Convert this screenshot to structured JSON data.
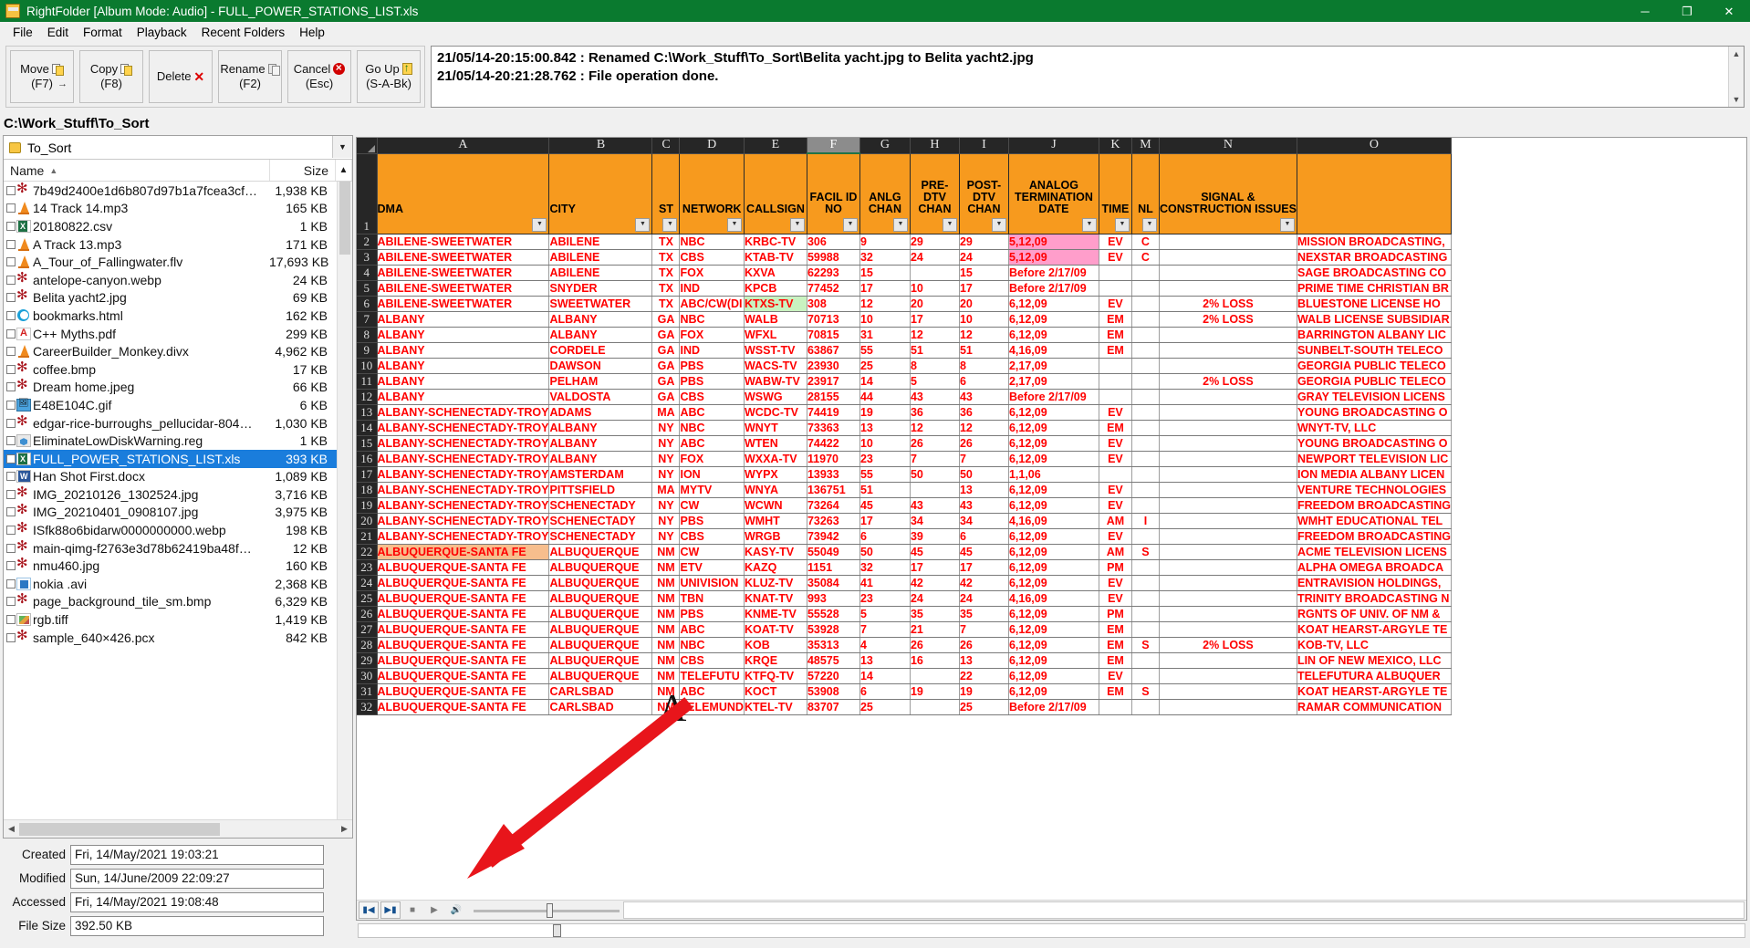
{
  "window": {
    "title": "RightFolder [Album Mode: Audio] - FULL_POWER_STATIONS_LIST.xls",
    "minimize": "─",
    "maximize": "❐",
    "close": "✕"
  },
  "menu": [
    "File",
    "Edit",
    "Format",
    "Playback",
    "Recent Folders",
    "Help"
  ],
  "toolbar": {
    "buttons": [
      {
        "l1": "Move",
        "l2": "(F7)",
        "icon": "move-pages-icon"
      },
      {
        "l1": "Copy",
        "l2": "(F8)",
        "icon": "copy-pages-icon"
      },
      {
        "l1": "Delete",
        "l2": "",
        "icon": "red-x-icon"
      },
      {
        "l1": "Rename",
        "l2": "(F2)",
        "icon": "rename-pages-icon"
      },
      {
        "l1": "Cancel",
        "l2": "(Esc)",
        "icon": "red-circle-x-icon"
      },
      {
        "l1": "Go Up",
        "l2": "(S-A-Bk)",
        "icon": "up-arrow-folder-icon"
      }
    ]
  },
  "log": {
    "lines": [
      "21/05/14-20:15:00.842 : Renamed C:\\Work_Stuff\\To_Sort\\Belita yacht.jpg to Belita yacht2.jpg",
      "21/05/14-20:21:28.762 : File operation done."
    ]
  },
  "path": "C:\\Work_Stuff\\To_Sort",
  "folder_combo": {
    "value": "To_Sort"
  },
  "file_list": {
    "columns": [
      "Name",
      "Size"
    ],
    "sort_indicator": "▲",
    "rows": [
      {
        "name": "7b49d2400e1d6b807d97b1a7fcea3cf…",
        "size": "1,938 KB",
        "icon": "i-img"
      },
      {
        "name": "14 Track 14.mp3",
        "size": "165 KB",
        "icon": "i-vlc"
      },
      {
        "name": "20180822.csv",
        "size": "1 KB",
        "icon": "i-xls"
      },
      {
        "name": "A Track 13.mp3",
        "size": "171 KB",
        "icon": "i-vlc"
      },
      {
        "name": "A_Tour_of_Fallingwater.flv",
        "size": "17,693 KB",
        "icon": "i-vlc"
      },
      {
        "name": "antelope-canyon.webp",
        "size": "24 KB",
        "icon": "i-img"
      },
      {
        "name": "Belita yacht2.jpg",
        "size": "69 KB",
        "icon": "i-img"
      },
      {
        "name": "bookmarks.html",
        "size": "162 KB",
        "icon": "i-edge"
      },
      {
        "name": "C++ Myths.pdf",
        "size": "299 KB",
        "icon": "i-pdf"
      },
      {
        "name": "CareerBuilder_Monkey.divx",
        "size": "4,962 KB",
        "icon": "i-vlc"
      },
      {
        "name": "coffee.bmp",
        "size": "17 KB",
        "icon": "i-img"
      },
      {
        "name": "Dream home.jpeg",
        "size": "66 KB",
        "icon": "i-img"
      },
      {
        "name": "E48E104C.gif",
        "size": "6 KB",
        "icon": "i-gif"
      },
      {
        "name": "edgar-rice-burroughs_pellucidar-804…",
        "size": "1,030 KB",
        "icon": "i-img"
      },
      {
        "name": "EliminateLowDiskWarning.reg",
        "size": "1 KB",
        "icon": "i-reg"
      },
      {
        "name": "FULL_POWER_STATIONS_LIST.xls",
        "size": "393 KB",
        "icon": "i-xls2",
        "selected": true
      },
      {
        "name": "Han Shot First.docx",
        "size": "1,089 KB",
        "icon": "i-doc"
      },
      {
        "name": "IMG_20210126_1302524.jpg",
        "size": "3,716 KB",
        "icon": "i-img"
      },
      {
        "name": "IMG_20210401_0908107.jpg",
        "size": "3,975 KB",
        "icon": "i-img"
      },
      {
        "name": "ISfk88o6bidarw0000000000.webp",
        "size": "198 KB",
        "icon": "i-img"
      },
      {
        "name": "main-qimg-f2763e3d78b62419ba48f…",
        "size": "12 KB",
        "icon": "i-img"
      },
      {
        "name": "nmu460.jpg",
        "size": "160 KB",
        "icon": "i-img"
      },
      {
        "name": "nokia .avi",
        "size": "2,368 KB",
        "icon": "i-avi"
      },
      {
        "name": "page_background_tile_sm.bmp",
        "size": "6,329 KB",
        "icon": "i-img"
      },
      {
        "name": "rgb.tiff",
        "size": "1,419 KB",
        "icon": "i-tiff"
      },
      {
        "name": "sample_640×426.pcx",
        "size": "842 KB",
        "icon": "i-img"
      }
    ]
  },
  "metadata": {
    "fields": [
      {
        "label": "Created",
        "value": "Fri, 14/May/2021 19:03:21"
      },
      {
        "label": "Modified",
        "value": "Sun, 14/June/2009 22:09:27"
      },
      {
        "label": "Accessed",
        "value": "Fri, 14/May/2021 19:08:48"
      },
      {
        "label": "File Size",
        "value": "392.50 KB"
      }
    ]
  },
  "spreadsheet": {
    "column_letters": [
      "A",
      "B",
      "C",
      "D",
      "E",
      "F",
      "G",
      "H",
      "I",
      "J",
      "K",
      "M",
      "N",
      "O"
    ],
    "active_column": "F",
    "headers": [
      "DMA",
      "CITY",
      "ST",
      "NETWORK",
      "CALLSIGN",
      "FACIL ID NO",
      "ANLG CHAN",
      "PRE-DTV CHAN",
      "POST-DTV CHAN",
      "ANALOG TERMINATION DATE",
      "TIME",
      "NL",
      "SIGNAL & CONSTRUCTION ISSUES",
      ""
    ],
    "header_row_number": "1",
    "rows": [
      {
        "n": "2",
        "c": [
          "ABILENE-SWEETWATER",
          "ABILENE",
          "TX",
          "NBC",
          "KRBC-TV",
          "306",
          "9",
          "29",
          "29",
          "5,12,09",
          "EV",
          "C",
          "",
          "MISSION BROADCASTING,"
        ],
        "hl": {
          "9": "pink"
        }
      },
      {
        "n": "3",
        "c": [
          "ABILENE-SWEETWATER",
          "ABILENE",
          "TX",
          "CBS",
          "KTAB-TV",
          "59988",
          "32",
          "24",
          "24",
          "5,12,09",
          "EV",
          "C",
          "",
          "NEXSTAR BROADCASTING"
        ],
        "hl": {
          "9": "pink"
        }
      },
      {
        "n": "4",
        "c": [
          "ABILENE-SWEETWATER",
          "ABILENE",
          "TX",
          "FOX",
          "KXVA",
          "62293",
          "15",
          "",
          "15",
          "Before 2/17/09",
          "",
          "",
          "",
          "SAGE BROADCASTING CO"
        ]
      },
      {
        "n": "5",
        "c": [
          "ABILENE-SWEETWATER",
          "SNYDER",
          "TX",
          "IND",
          "KPCB",
          "77452",
          "17",
          "10",
          "17",
          "Before 2/17/09",
          "",
          "",
          "",
          "PRIME TIME CHRISTIAN BR"
        ]
      },
      {
        "n": "6",
        "c": [
          "ABILENE-SWEETWATER",
          "SWEETWATER",
          "TX",
          "ABC/CW(DI",
          "KTXS-TV",
          "308",
          "12",
          "20",
          "20",
          "6,12,09",
          "EV",
          "",
          "2% LOSS",
          "BLUESTONE LICENSE HO"
        ],
        "hl": {
          "4": "green"
        }
      },
      {
        "n": "7",
        "c": [
          "ALBANY",
          "ALBANY",
          "GA",
          "NBC",
          "WALB",
          "70713",
          "10",
          "17",
          "10",
          "6,12,09",
          "EM",
          "",
          "2% LOSS",
          "WALB LICENSE SUBSIDIAR"
        ]
      },
      {
        "n": "8",
        "c": [
          "ALBANY",
          "ALBANY",
          "GA",
          "FOX",
          "WFXL",
          "70815",
          "31",
          "12",
          "12",
          "6,12,09",
          "EM",
          "",
          "",
          "BARRINGTON ALBANY LIC"
        ]
      },
      {
        "n": "9",
        "c": [
          "ALBANY",
          "CORDELE",
          "GA",
          "IND",
          "WSST-TV",
          "63867",
          "55",
          "51",
          "51",
          "4,16,09",
          "EM",
          "",
          "",
          "SUNBELT-SOUTH TELECO"
        ]
      },
      {
        "n": "10",
        "c": [
          "ALBANY",
          "DAWSON",
          "GA",
          "PBS",
          "WACS-TV",
          "23930",
          "25",
          "8",
          "8",
          "2,17,09",
          "",
          "",
          "",
          "GEORGIA PUBLIC TELECO"
        ]
      },
      {
        "n": "11",
        "c": [
          "ALBANY",
          "PELHAM",
          "GA",
          "PBS",
          "WABW-TV",
          "23917",
          "14",
          "5",
          "6",
          "2,17,09",
          "",
          "",
          "2% LOSS",
          "GEORGIA PUBLIC TELECO"
        ]
      },
      {
        "n": "12",
        "c": [
          "ALBANY",
          "VALDOSTA",
          "GA",
          "CBS",
          "WSWG",
          "28155",
          "44",
          "43",
          "43",
          "Before 2/17/09",
          "",
          "",
          "",
          "GRAY TELEVISION LICENS"
        ]
      },
      {
        "n": "13",
        "c": [
          "ALBANY-SCHENECTADY-TROY",
          "ADAMS",
          "MA",
          "ABC",
          "WCDC-TV",
          "74419",
          "19",
          "36",
          "36",
          "6,12,09",
          "EV",
          "",
          "",
          "YOUNG BROADCASTING O"
        ]
      },
      {
        "n": "14",
        "c": [
          "ALBANY-SCHENECTADY-TROY",
          "ALBANY",
          "NY",
          "NBC",
          "WNYT",
          "73363",
          "13",
          "12",
          "12",
          "6,12,09",
          "EM",
          "",
          "",
          "WNYT-TV, LLC"
        ]
      },
      {
        "n": "15",
        "c": [
          "ALBANY-SCHENECTADY-TROY",
          "ALBANY",
          "NY",
          "ABC",
          "WTEN",
          "74422",
          "10",
          "26",
          "26",
          "6,12,09",
          "EV",
          "",
          "",
          "YOUNG BROADCASTING O"
        ]
      },
      {
        "n": "16",
        "c": [
          "ALBANY-SCHENECTADY-TROY",
          "ALBANY",
          "NY",
          "FOX",
          "WXXA-TV",
          "11970",
          "23",
          "7",
          "7",
          "6,12,09",
          "EV",
          "",
          "",
          "NEWPORT TELEVISION LIC"
        ]
      },
      {
        "n": "17",
        "c": [
          "ALBANY-SCHENECTADY-TROY",
          "AMSTERDAM",
          "NY",
          "ION",
          "WYPX",
          "13933",
          "55",
          "50",
          "50",
          "1,1,06",
          "",
          "",
          "",
          "ION MEDIA ALBANY LICEN"
        ]
      },
      {
        "n": "18",
        "c": [
          "ALBANY-SCHENECTADY-TROY",
          "PITTSFIELD",
          "MA",
          "MYTV",
          "WNYA",
          "136751",
          "51",
          "",
          "13",
          "6,12,09",
          "EV",
          "",
          "",
          "VENTURE TECHNOLOGIES"
        ]
      },
      {
        "n": "19",
        "c": [
          "ALBANY-SCHENECTADY-TROY",
          "SCHENECTADY",
          "NY",
          "CW",
          "WCWN",
          "73264",
          "45",
          "43",
          "43",
          "6,12,09",
          "EV",
          "",
          "",
          "FREEDOM BROADCASTING"
        ]
      },
      {
        "n": "20",
        "c": [
          "ALBANY-SCHENECTADY-TROY",
          "SCHENECTADY",
          "NY",
          "PBS",
          "WMHT",
          "73263",
          "17",
          "34",
          "34",
          "4,16,09",
          "AM",
          "I",
          "",
          "WMHT EDUCATIONAL TEL"
        ]
      },
      {
        "n": "21",
        "c": [
          "ALBANY-SCHENECTADY-TROY",
          "SCHENECTADY",
          "NY",
          "CBS",
          "WRGB",
          "73942",
          "6",
          "39",
          "6",
          "6,12,09",
          "EV",
          "",
          "",
          "FREEDOM BROADCASTING"
        ]
      },
      {
        "n": "22",
        "c": [
          "ALBUQUERQUE-SANTA FE",
          "ALBUQUERQUE",
          "NM",
          "CW",
          "KASY-TV",
          "55049",
          "50",
          "45",
          "45",
          "6,12,09",
          "AM",
          "S",
          "",
          "ACME TELEVISION LICENS"
        ],
        "hl": {
          "0": "peach"
        }
      },
      {
        "n": "23",
        "c": [
          "ALBUQUERQUE-SANTA FE",
          "ALBUQUERQUE",
          "NM",
          "ETV",
          "KAZQ",
          "1151",
          "32",
          "17",
          "17",
          "6,12,09",
          "PM",
          "",
          "",
          "ALPHA OMEGA BROADCA"
        ]
      },
      {
        "n": "24",
        "c": [
          "ALBUQUERQUE-SANTA FE",
          "ALBUQUERQUE",
          "NM",
          "UNIVISION",
          "KLUZ-TV",
          "35084",
          "41",
          "42",
          "42",
          "6,12,09",
          "EV",
          "",
          "",
          "ENTRAVISION HOLDINGS,"
        ]
      },
      {
        "n": "25",
        "c": [
          "ALBUQUERQUE-SANTA FE",
          "ALBUQUERQUE",
          "NM",
          "TBN",
          "KNAT-TV",
          "993",
          "23",
          "24",
          "24",
          "4,16,09",
          "EV",
          "",
          "",
          "TRINITY BROADCASTING N"
        ]
      },
      {
        "n": "26",
        "c": [
          "ALBUQUERQUE-SANTA FE",
          "ALBUQUERQUE",
          "NM",
          "PBS",
          "KNME-TV",
          "55528",
          "5",
          "35",
          "35",
          "6,12,09",
          "PM",
          "",
          "",
          "RGNTS OF UNIV. OF NM &"
        ]
      },
      {
        "n": "27",
        "c": [
          "ALBUQUERQUE-SANTA FE",
          "ALBUQUERQUE",
          "NM",
          "ABC",
          "KOAT-TV",
          "53928",
          "7",
          "21",
          "7",
          "6,12,09",
          "EM",
          "",
          "",
          "KOAT HEARST-ARGYLE TE"
        ]
      },
      {
        "n": "28",
        "c": [
          "ALBUQUERQUE-SANTA FE",
          "ALBUQUERQUE",
          "NM",
          "NBC",
          "KOB",
          "35313",
          "4",
          "26",
          "26",
          "6,12,09",
          "EM",
          "S",
          "2% LOSS",
          "KOB-TV, LLC"
        ]
      },
      {
        "n": "29",
        "c": [
          "ALBUQUERQUE-SANTA FE",
          "ALBUQUERQUE",
          "NM",
          "CBS",
          "KRQE",
          "48575",
          "13",
          "16",
          "13",
          "6,12,09",
          "EM",
          "",
          "",
          "LIN OF NEW MEXICO, LLC"
        ]
      },
      {
        "n": "30",
        "c": [
          "ALBUQUERQUE-SANTA FE",
          "ALBUQUERQUE",
          "NM",
          "TELEFUTU",
          "KTFQ-TV",
          "57220",
          "14",
          "",
          "22",
          "6,12,09",
          "EV",
          "",
          "",
          "TELEFUTURA ALBUQUER"
        ]
      },
      {
        "n": "31",
        "c": [
          "ALBUQUERQUE-SANTA FE",
          "CARLSBAD",
          "NM",
          "ABC",
          "KOCT",
          "53908",
          "6",
          "19",
          "19",
          "6,12,09",
          "EM",
          "S",
          "",
          "KOAT HEARST-ARGYLE TE"
        ]
      },
      {
        "n": "32",
        "c": [
          "ALBUQUERQUE-SANTA FE",
          "CARLSBAD",
          "NM",
          "TELEMUND",
          "KTEL-TV",
          "83707",
          "25",
          "",
          "25",
          "Before 2/17/09",
          "",
          "",
          "",
          "RAMAR COMMUNICATION"
        ]
      }
    ]
  },
  "player": {
    "buttons": [
      "prev-track-icon",
      "next-track-icon",
      "stop-icon",
      "play-icon",
      "mute-icon"
    ]
  },
  "annotation": {
    "letter": "A",
    "arrow": "red-arrow-pointer"
  },
  "colors": {
    "titlebar": "#0a7a2f",
    "header_orange": "#F79A1E",
    "cell_text_red": "#FF0000",
    "highlight_pink": "#FF9ECB",
    "highlight_green": "#C9F2C0",
    "highlight_peach": "#F7BE8D",
    "selection_blue": "#1A7DDC",
    "annotation_red": "#E8151B"
  }
}
